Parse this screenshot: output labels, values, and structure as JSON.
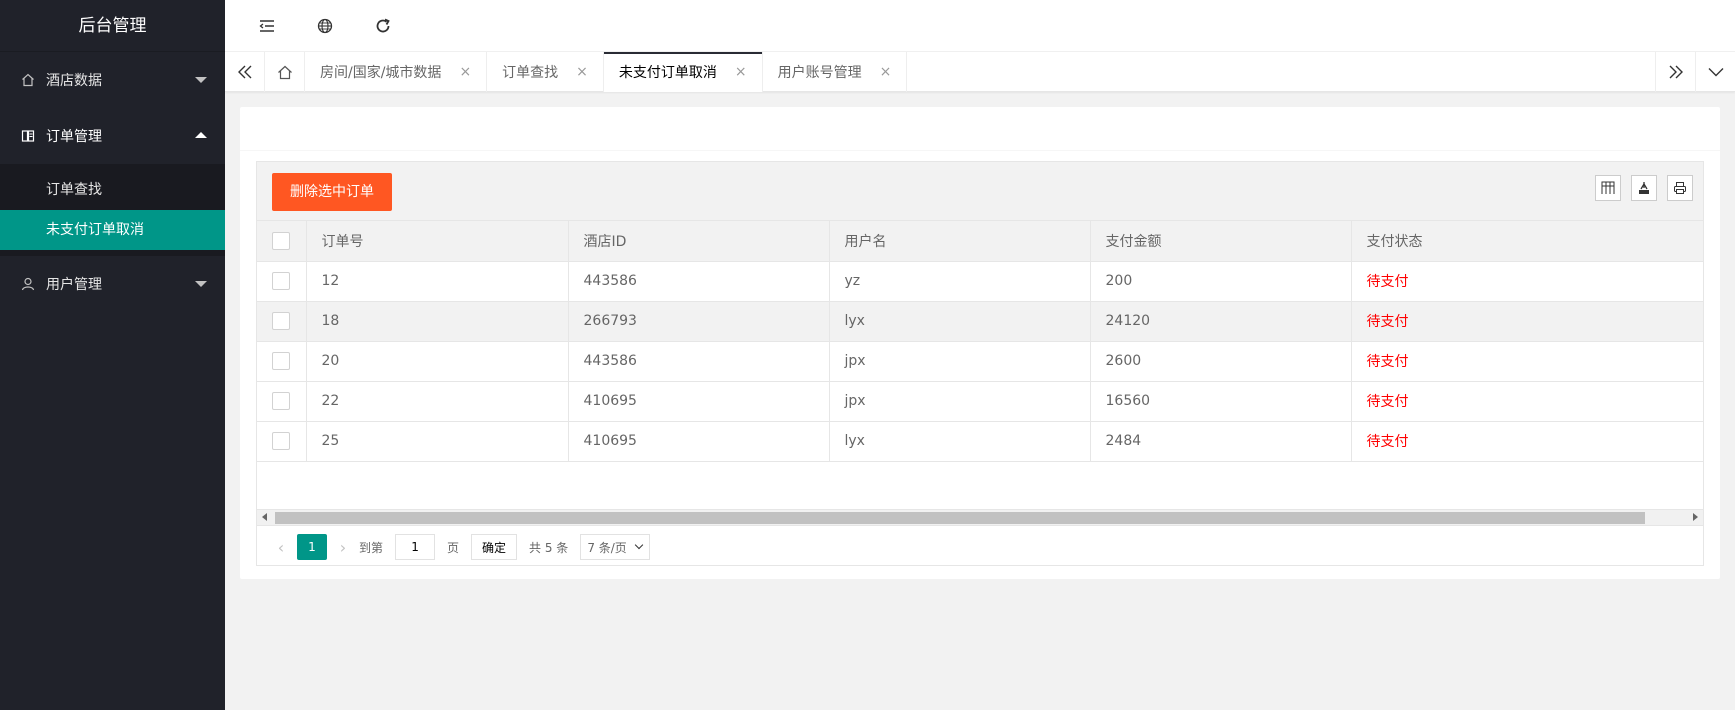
{
  "app": {
    "title": "后台管理"
  },
  "sidebar": {
    "items": [
      {
        "label": "酒店数据",
        "icon": "home-icon",
        "open": false
      },
      {
        "label": "订单管理",
        "icon": "book-icon",
        "open": true,
        "children": [
          {
            "label": "订单查找",
            "active": false
          },
          {
            "label": "未支付订单取消",
            "active": true
          }
        ]
      },
      {
        "label": "用户管理",
        "icon": "user-icon",
        "open": false
      }
    ]
  },
  "header": {
    "icons": [
      "menu-fold-icon",
      "globe-icon",
      "refresh-icon"
    ]
  },
  "tabs": {
    "items": [
      {
        "label": "房间/国家/城市数据",
        "active": false
      },
      {
        "label": "订单查找",
        "active": false
      },
      {
        "label": "未支付订单取消",
        "active": true
      },
      {
        "label": "用户账号管理",
        "active": false
      }
    ],
    "close_glyph": "×"
  },
  "toolbar": {
    "delete_label": "删除选中订单"
  },
  "table": {
    "columns": [
      "订单号",
      "酒店ID",
      "用户名",
      "支付金额",
      "支付状态"
    ],
    "rows": [
      [
        "12",
        "443586",
        "yz",
        "200",
        "待支付"
      ],
      [
        "18",
        "266793",
        "lyx",
        "24120",
        "待支付"
      ],
      [
        "20",
        "443586",
        "jpx",
        "2600",
        "待支付"
      ],
      [
        "22",
        "410695",
        "jpx",
        "16560",
        "待支付"
      ],
      [
        "25",
        "410695",
        "lyx",
        "2484",
        "待支付"
      ]
    ]
  },
  "pager": {
    "current": "1",
    "goto_label": "到第",
    "goto_value": "1",
    "page_unit": "页",
    "confirm_label": "确定",
    "total_label": "共 5 条",
    "page_size_label": "7 条/页"
  },
  "colors": {
    "accent": "#009688",
    "danger": "#ff5722",
    "status": "#ff0000",
    "sidebar": "#20222a"
  }
}
